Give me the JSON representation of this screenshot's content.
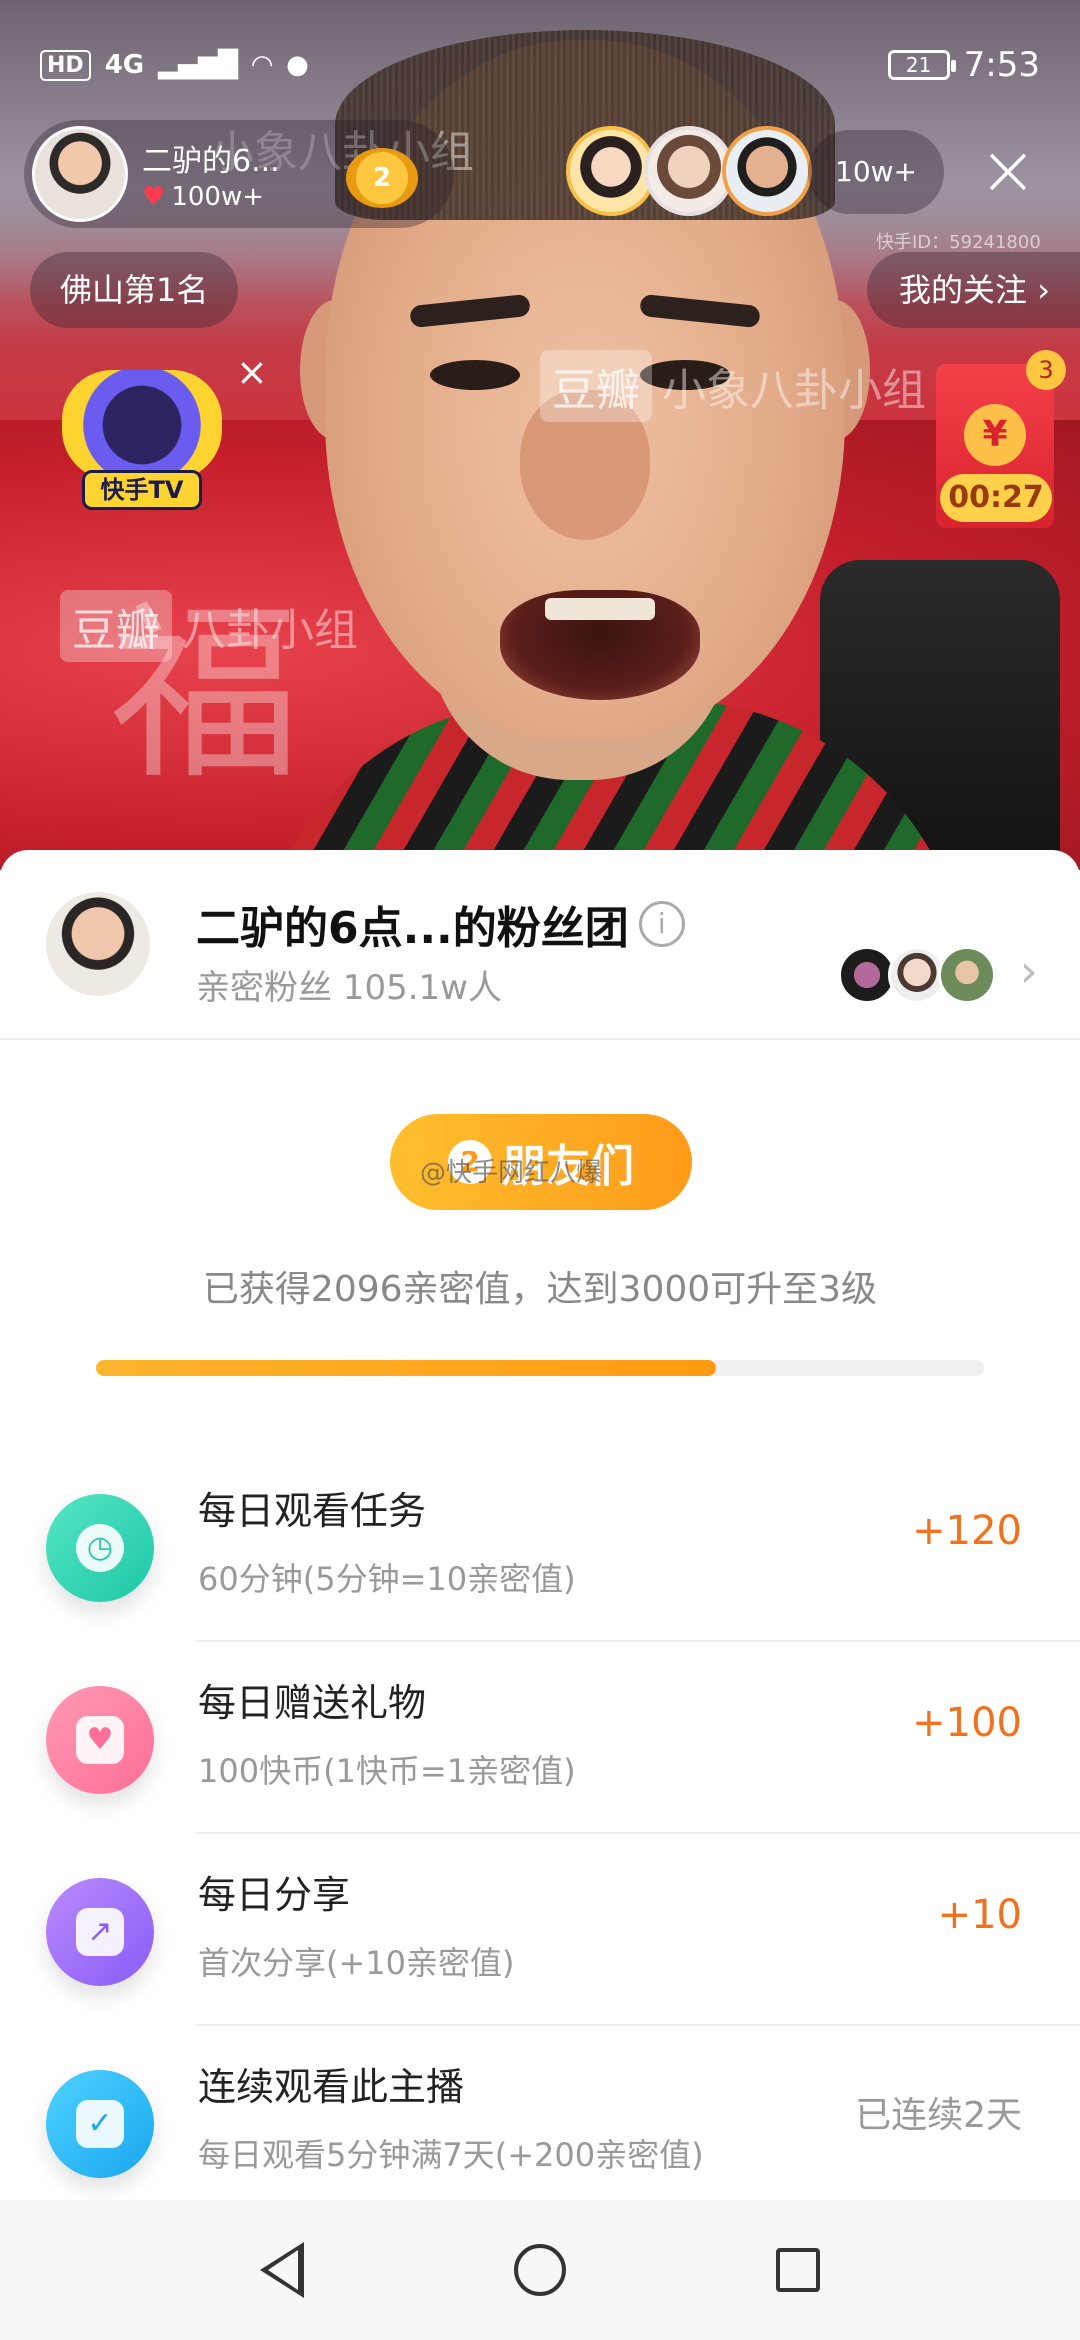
{
  "status_bar": {
    "hd": "HD",
    "network": "4G",
    "battery": "21",
    "time": "7:53"
  },
  "live": {
    "host_name": "二驴的6...",
    "host_likes": "100w+",
    "host_rank_badge": "2",
    "viewer_count": "10w+",
    "live_id": "快手ID：59241800",
    "rank_label": "佛山第1名",
    "follow_label": "我的关注 ›",
    "tv_label": "快手TV",
    "redpacket_count": "3",
    "redpacket_timer": "00:27",
    "watermarks": [
      "豆瓣",
      "小象八卦小组",
      "八卦小组"
    ],
    "background_text": "福"
  },
  "fan_group": {
    "title": "二驴的6点...的粉丝团",
    "subtitle": "亲密粉丝 105.1w人",
    "cta_label": "朋友们",
    "cta_icon_text": "2",
    "cta_overlay": "@快手网红八爆",
    "progress_text": "已获得2096亲密值，达到3000可升至3级",
    "progress_fraction": 0.6987
  },
  "tasks": [
    {
      "title": "每日观看任务",
      "desc": "60分钟(5分钟=10亲密值)",
      "reward": "+120",
      "status": "",
      "icon": "clock-icon",
      "color": "#1ec7a8"
    },
    {
      "title": "每日赠送礼物",
      "desc": "100快币(1快币=1亲密值)",
      "reward": "+100",
      "status": "",
      "icon": "gift-heart-icon",
      "color": "#ff6e96"
    },
    {
      "title": "每日分享",
      "desc": "首次分享(+10亲密值)",
      "reward": "+10",
      "status": "",
      "icon": "share-arrow-icon",
      "color": "#8a5cf6"
    },
    {
      "title": "连续观看此主播",
      "desc": "每日观看5分钟满7天(+200亲密值)",
      "reward": "",
      "status": "已连续2天",
      "icon": "calendar-check-icon",
      "color": "#1aa6f0"
    }
  ]
}
